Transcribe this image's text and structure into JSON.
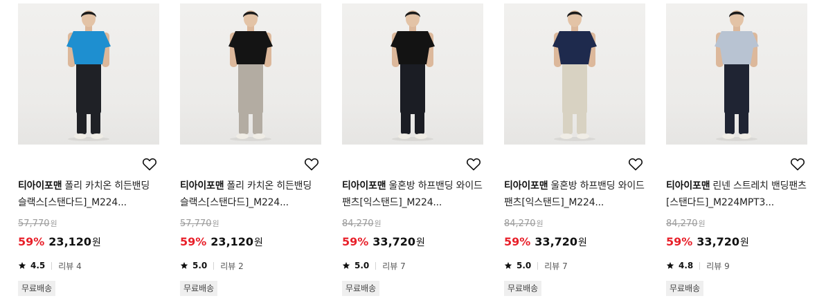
{
  "colors": {
    "discount": "#e8202a",
    "badge_bg": "#efefef",
    "photo_bg": "#eeedeb"
  },
  "icons": {
    "wishlist": "heart-outline-icon",
    "rating": "star-icon"
  },
  "products": [
    {
      "brand": "티아이포맨",
      "name": "폴리 카치온 히든밴딩 슬랙스[스탠다드]_M224...",
      "original_price": "57,770",
      "original_unit": "원",
      "discount": "59%",
      "price": "23,120",
      "price_unit": "원",
      "rating": "4.5",
      "review": "리뷰 4",
      "badge": "무료배송",
      "top_color": "#1e8fd0",
      "pants_color": "#1f2126"
    },
    {
      "brand": "티아이포맨",
      "name": "폴리 카치온 히든밴딩 슬랙스[스탠다드]_M224...",
      "original_price": "57,770",
      "original_unit": "원",
      "discount": "59%",
      "price": "23,120",
      "price_unit": "원",
      "rating": "5.0",
      "review": "리뷰 2",
      "badge": "무료배송",
      "top_color": "#141414",
      "pants_color": "#b3aca2"
    },
    {
      "brand": "티아이포맨",
      "name": "울혼방 하프밴딩 와이드 팬츠[익스탠드]_M224...",
      "original_price": "84,270",
      "original_unit": "원",
      "discount": "59%",
      "price": "33,720",
      "price_unit": "원",
      "rating": "5.0",
      "review": "리뷰 7",
      "badge": "무료배송",
      "top_color": "#131313",
      "pants_color": "#1b1d24"
    },
    {
      "brand": "티아이포맨",
      "name": "울혼방 하프밴딩 와이드 팬츠[익스탠드]_M224...",
      "original_price": "84,270",
      "original_unit": "원",
      "discount": "59%",
      "price": "33,720",
      "price_unit": "원",
      "rating": "5.0",
      "review": "리뷰 7",
      "badge": "무료배송",
      "top_color": "#1e2a4d",
      "pants_color": "#d8d2c2"
    },
    {
      "brand": "티아이포맨",
      "name": "린넨 스트레치 밴딩팬츠[스탠다드]_M224MPT3...",
      "original_price": "84,270",
      "original_unit": "원",
      "discount": "59%",
      "price": "33,720",
      "price_unit": "원",
      "rating": "4.8",
      "review": "리뷰 9",
      "badge": "무료배송",
      "top_color": "#b8c3d2",
      "pants_color": "#1f2433"
    }
  ]
}
